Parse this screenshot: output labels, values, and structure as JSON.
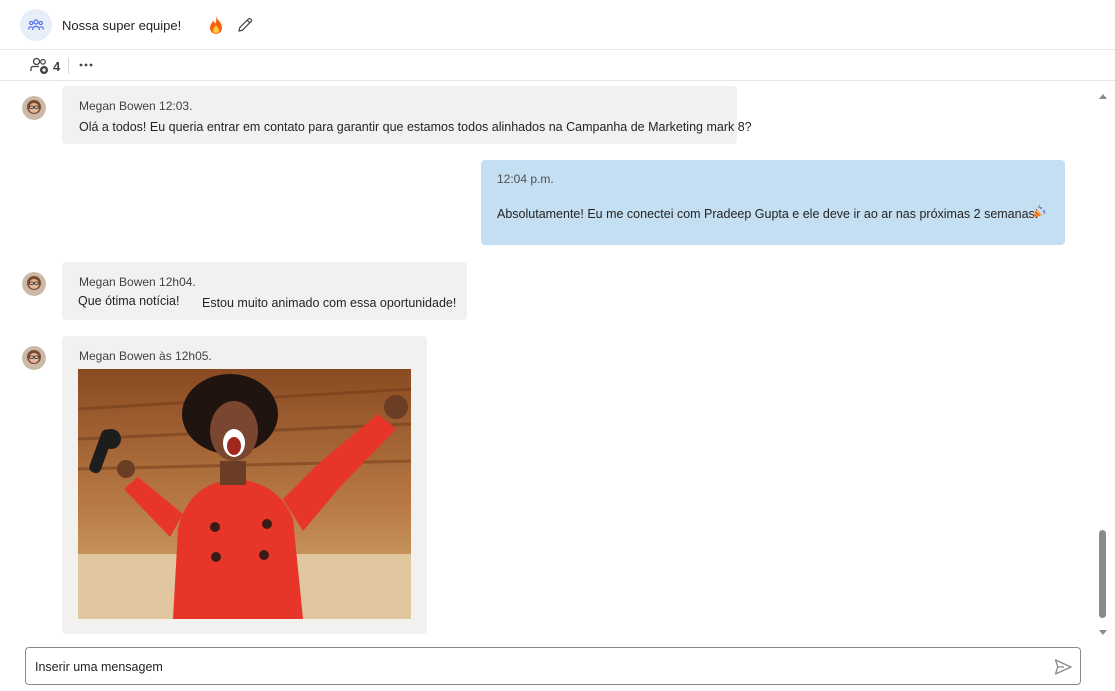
{
  "header": {
    "title": "Nossa super equipe!",
    "team_icon": "people-team-icon",
    "reaction_icon": "fire-icon",
    "edit_icon": "pencil-icon"
  },
  "toolbar": {
    "participants_icon": "people-add-icon",
    "participants_count": "4",
    "more_icon": "more-horizontal-icon"
  },
  "messages": [
    {
      "sender_time": "Megan Bowen 12:03.",
      "text": "Olá a todos! Eu queria entrar em contato para garantir que estamos todos alinhados na Campanha de Marketing mark 8?"
    },
    {
      "time": "12:04 p.m.",
      "text": "Absolutamente! Eu me conectei com Pradeep Gupta e ele deve ir ao ar nas próximas 2 semanas!",
      "reaction_icon": "party-popper-icon"
    },
    {
      "sender_time": "Megan Bowen 12h04.",
      "text_a": "Que ótima notícia!",
      "text_b": "Estou muito animado com essa oportunidade!"
    },
    {
      "sender_time": "Megan Bowen às 12h05.",
      "attachment": "gif-image"
    }
  ],
  "compose": {
    "placeholder": "Inserir uma mensagem",
    "send_icon": "send-icon"
  },
  "colors": {
    "own_bubble": "#c5dff2",
    "other_bubble": "#f2f1f0",
    "fire": "#f7630c"
  }
}
